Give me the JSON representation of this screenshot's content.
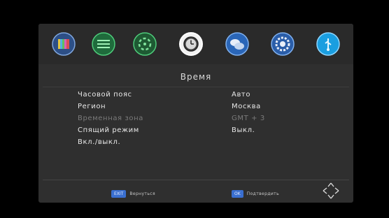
{
  "menu": {
    "icons": [
      {
        "name": "picture-icon",
        "selected": false
      },
      {
        "name": "channel-list-icon",
        "selected": false
      },
      {
        "name": "search-icon",
        "selected": false
      },
      {
        "name": "clock-icon",
        "selected": true
      },
      {
        "name": "language-icon",
        "selected": false
      },
      {
        "name": "system-settings-icon",
        "selected": false
      },
      {
        "name": "usb-icon",
        "selected": false
      }
    ]
  },
  "page": {
    "title": "Время"
  },
  "settings": [
    {
      "label": "Часовой пояс",
      "value": "Авто",
      "enabled": true
    },
    {
      "label": "Регион",
      "value": "Москва",
      "enabled": true
    },
    {
      "label": "Временная зона",
      "value": "GMT + 3",
      "enabled": false
    },
    {
      "label": "Спящий режим",
      "value": "Выкл.",
      "enabled": true
    },
    {
      "label": "Вкл./выкл.",
      "value": "",
      "enabled": true
    }
  ],
  "footer": {
    "back_key": "EXIT",
    "back_label": "Вернуться",
    "ok_key": "OK",
    "ok_label": "Подтвердить",
    "nav_icon": "navigation-arrows-icon"
  },
  "colors": {
    "accent": "#3a6fd0",
    "panel": "#2f2f2f",
    "disabled_text": "#7a7a7a"
  }
}
